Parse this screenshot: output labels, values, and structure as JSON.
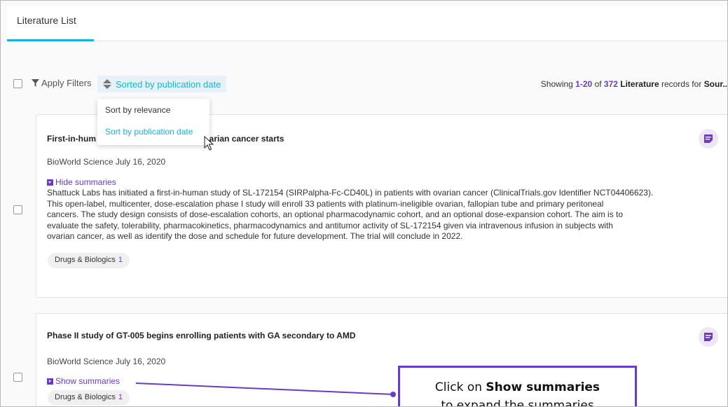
{
  "tab": {
    "label": "Literature List"
  },
  "toolbar": {
    "filter_label": "Apply Filters",
    "sort_label": "Sorted by publication date",
    "showing_prefix": "Showing ",
    "showing_range": "1-20",
    "showing_of": " of ",
    "showing_total": "372",
    "showing_type": "Literature",
    "showing_suffix": " records for ",
    "showing_source": "Sour.."
  },
  "dropdown": {
    "options": [
      "Sort by relevance",
      "Sort by publication date"
    ],
    "selected": "Sort by publication date"
  },
  "records": [
    {
      "title_start": "First-in-hum",
      "title_end": "varian cancer starts",
      "source": "BioWorld Science July 16, 2020",
      "toggle": "Hide summaries",
      "summary_lines": [
        "Shattuck Labs has initiated a first-in-human study of SL-172154 (SIRPalpha-Fc-CD40L) in patients with ovarian cancer (ClinicalTrials.gov Identifier NCT04406623).",
        "This open-label, multicenter, dose-escalation phase I study will enroll 33 patients with platinum-ineligible ovarian, fallopian tube and primary peritoneal",
        "cancers. The study design consists of dose-escalation cohorts, an optional pharmacodynamic cohort, and an optional dose-expansion cohort. The aim is to",
        "evaluate the safety, tolerability, pharmacokinetics, pharmacodynamics and antitumor activity of SL-172154 given via intravenous infusion in subjects with",
        "ovarian cancer, as well as identify the dose and schedule for future development. The trial will conclude in 2022."
      ],
      "tag_label": "Drugs & Biologics",
      "tag_count": "1"
    },
    {
      "title": "Phase II study of GT-005 begins enrolling patients with GA secondary to AMD",
      "source": "BioWorld Science July 16, 2020",
      "toggle": "Show summaries",
      "tag_label": "Drugs & Biologics",
      "tag_count": "1"
    }
  ],
  "callout": {
    "prefix": "Click on ",
    "bold": "Show summaries",
    "line2": "to expand the summaries"
  },
  "colors": {
    "accent": "#14b4d6",
    "purple": "#6a3bc4"
  }
}
